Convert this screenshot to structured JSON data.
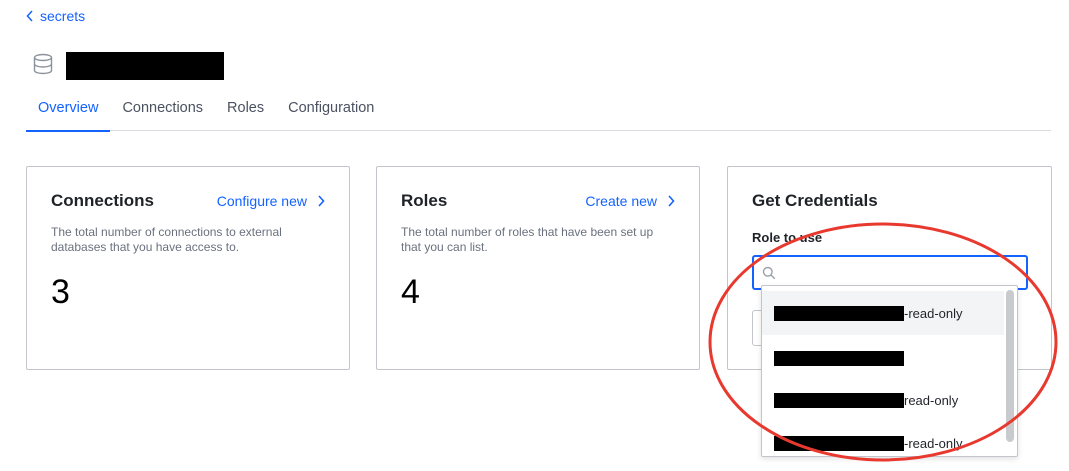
{
  "breadcrumb": {
    "label": "secrets"
  },
  "tabs": [
    {
      "label": "Overview",
      "active": true
    },
    {
      "label": "Connections",
      "active": false
    },
    {
      "label": "Roles",
      "active": false
    },
    {
      "label": "Configuration",
      "active": false
    }
  ],
  "cards": {
    "connections": {
      "title": "Connections",
      "link": "Configure new",
      "description": "The total number of connections to external databases that you have access to.",
      "count": "3"
    },
    "roles": {
      "title": "Roles",
      "link": "Create new",
      "description": "The total number of roles that have been set up that you can list.",
      "count": "4"
    },
    "credentials": {
      "title": "Get Credentials",
      "field_label": "Role to use",
      "search_value": ""
    }
  },
  "dropdown": {
    "options": [
      {
        "suffix": "-read-only",
        "highlighted": true
      },
      {
        "suffix": "",
        "highlighted": false
      },
      {
        "suffix": "read-only",
        "highlighted": false
      },
      {
        "suffix": "-read-only",
        "highlighted": false
      }
    ]
  },
  "colors": {
    "accent": "#1563ff",
    "annotation": "#e8392f"
  },
  "icons": {
    "title_icon": "database-icon",
    "back_icon": "chevron-left-icon",
    "link_icon": "chevron-right-icon",
    "search_icon": "search-icon"
  }
}
